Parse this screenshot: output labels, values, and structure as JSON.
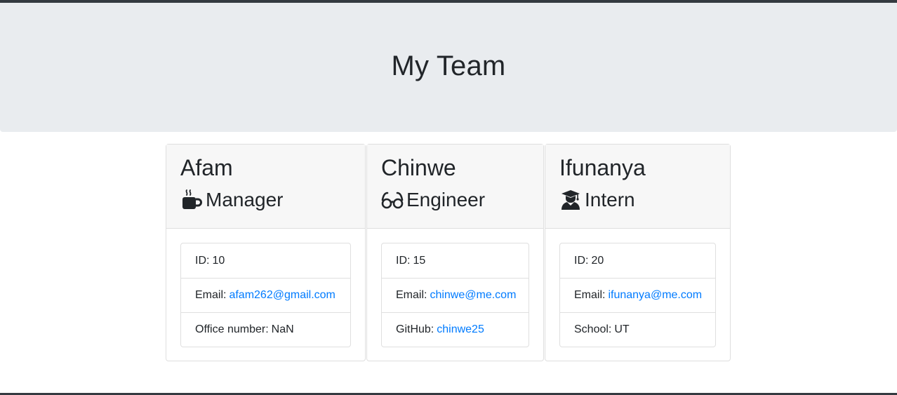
{
  "header": {
    "title": "My Team"
  },
  "cards": [
    {
      "name": "Afam",
      "role": "Manager",
      "role_icon": "mug-icon",
      "id_label": "ID:",
      "id_value": "10",
      "email_label": "Email:",
      "email_value": "afam262@gmail.com",
      "extra_label": "Office number:",
      "extra_value": "NaN"
    },
    {
      "name": "Chinwe",
      "role": "Engineer",
      "role_icon": "glasses-icon",
      "id_label": "ID:",
      "id_value": "15",
      "email_label": "Email:",
      "email_value": "chinwe@me.com",
      "extra_label": "GitHub:",
      "extra_value": "chinwe25"
    },
    {
      "name": "Ifunanya",
      "role": "Intern",
      "role_icon": "graduate-icon",
      "id_label": "ID:",
      "id_value": "20",
      "email_label": "Email:",
      "email_value": "ifunanya@me.com",
      "extra_label": "School:",
      "extra_value": "UT"
    }
  ],
  "colors": {
    "link": "#007bff",
    "jumbotron_bg": "#e9ecef",
    "card_header_bg": "#f7f7f7",
    "border": "#dfdfdf",
    "dark_bar": "#343a40"
  }
}
